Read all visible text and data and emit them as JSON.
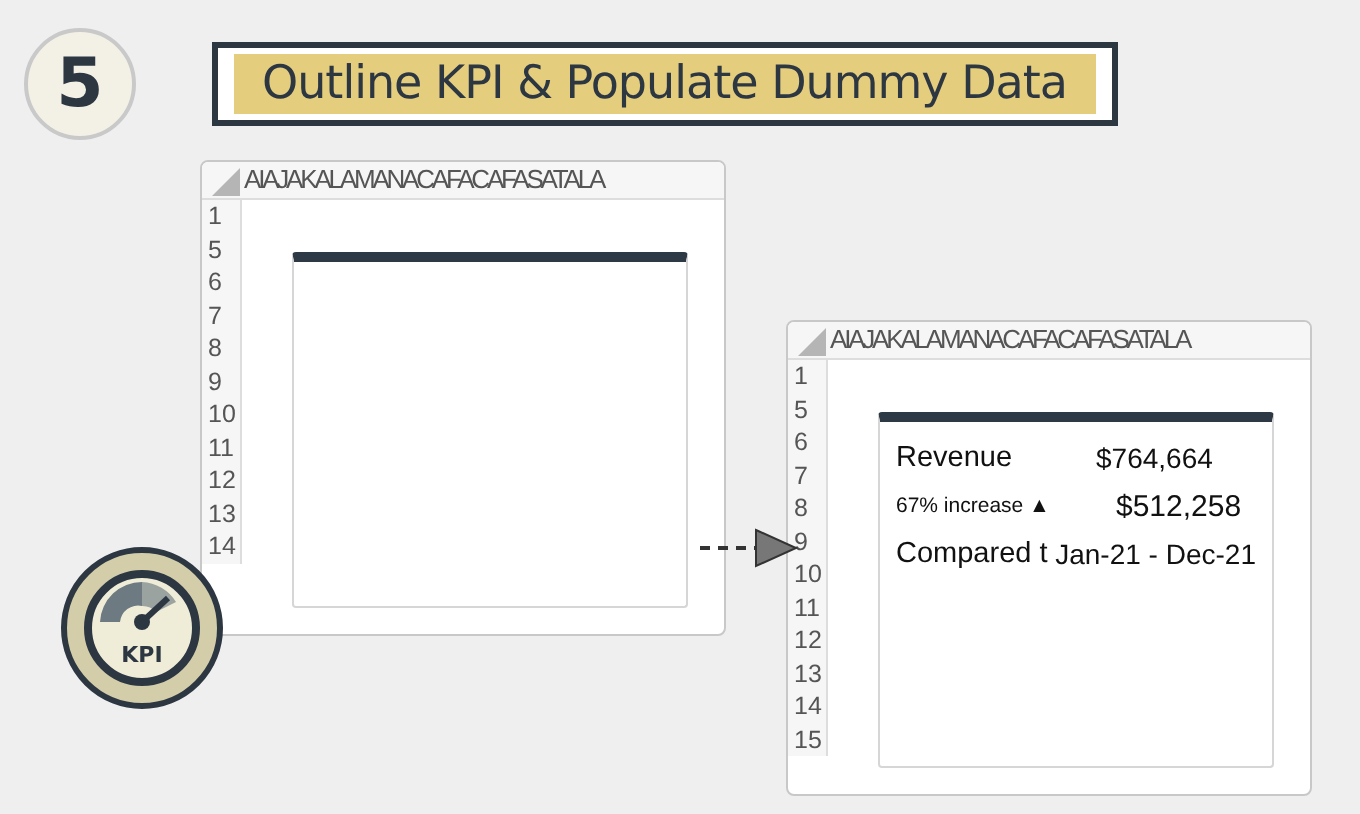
{
  "step": {
    "number": "5",
    "title": "Outline KPI & Populate Dummy Data"
  },
  "sheets": [
    {
      "column_headers": "AIAJAKALAMANACAFACAFASATALA",
      "row_numbers": [
        "1",
        "5",
        "6",
        "7",
        "8",
        "9",
        "10",
        "11",
        "12",
        "13",
        "14"
      ]
    },
    {
      "column_headers": "AIAJAKALAMANACAFACAFASATALA",
      "row_numbers": [
        "1",
        "5",
        "6",
        "7",
        "8",
        "9",
        "10",
        "11",
        "12",
        "13",
        "14",
        "15"
      ],
      "kpi_rows": [
        {
          "kind": "large",
          "label": "Revenue",
          "value": "$764,664"
        },
        {
          "kind": "small",
          "label": "67% increase ▲",
          "value": "$512,258"
        },
        {
          "kind": "large",
          "label": "Compared t",
          "value": "Jan-21 - Dec-21"
        }
      ]
    }
  ],
  "badge": {
    "label": "KPI"
  }
}
